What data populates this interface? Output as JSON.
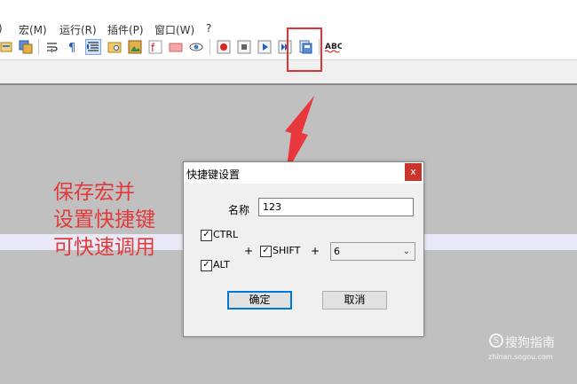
{
  "menubar": {
    "items": [
      ")",
      "宏(M)",
      "运行(R)",
      "插件(P)",
      "窗口(W)",
      "?"
    ]
  },
  "toolbar": {
    "icons": [
      "replace-icon",
      "save-all-icon",
      "wrap-icon",
      "paragraph-icon",
      "indent-icon",
      "folder-icon",
      "image-icon",
      "function-icon",
      "close-file-icon",
      "eye-icon",
      "record-macro-icon",
      "stop-record-icon",
      "play-macro-icon",
      "run-multiple-icon",
      "save-macro-icon",
      "spellcheck-icon"
    ],
    "spellcheck_label": "ABC"
  },
  "annotation": {
    "lines": [
      "保存宏并",
      "设置快捷键",
      "可快速调用"
    ],
    "color": "#e23a3a"
  },
  "dialog": {
    "title": "快捷键设置",
    "close_label": "x",
    "name_label": "名称",
    "name_value": "123",
    "ctrl_label": "CTRL",
    "alt_label": "ALT",
    "shift_label": "SHIFT",
    "plus1": "+",
    "plus2": "+",
    "key_value": "6",
    "ok_label": "确定",
    "cancel_label": "取消",
    "ctrl_checked": true,
    "alt_checked": true,
    "shift_checked": true
  },
  "watermark": {
    "brand": "搜狗指南",
    "logo_letter": "S",
    "url": "zhinan.sogou.com"
  }
}
